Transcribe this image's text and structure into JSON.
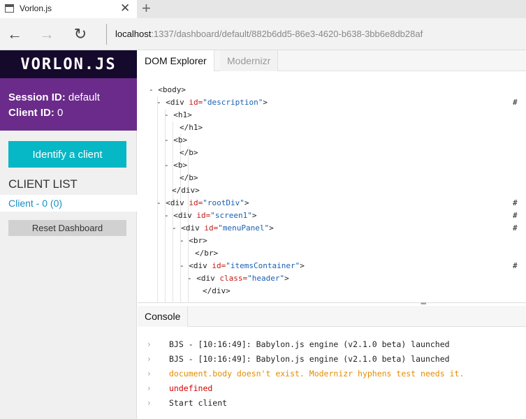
{
  "browser": {
    "tab_title": "Vorlon.js",
    "tab_close": "✕",
    "new_tab": "+",
    "back": "←",
    "forward": "→",
    "refresh": "↻",
    "url_host": "localhost",
    "url_rest": ":1337/dashboard/default/882b6dd5-86e3-4620-b638-3bb6e8db28af"
  },
  "sidebar": {
    "logo": "VORLON.JS",
    "session_label": "Session ID:",
    "session_value": "default",
    "client_label": "Client ID:",
    "client_value": "0",
    "identify_button": "Identify a client",
    "client_list_title": "CLIENT LIST",
    "clients": [
      "Client - 0 (0)"
    ],
    "reset_button": "Reset Dashboard"
  },
  "panels": {
    "tabs": [
      {
        "label": "DOM Explorer",
        "active": true
      },
      {
        "label": "Modernizr",
        "active": false
      }
    ],
    "console_tab": "Console"
  },
  "dom_tree": [
    {
      "indent": 0,
      "prefix": "- ",
      "text": "<body>",
      "attr": "",
      "val": "",
      "suffix": "",
      "hash": ""
    },
    {
      "indent": 1,
      "prefix": "- ",
      "text": "<div ",
      "attr": "id=",
      "val": "\"description\"",
      "suffix": ">",
      "hash": "#"
    },
    {
      "indent": 2,
      "prefix": "- ",
      "text": "<h1>",
      "attr": "",
      "val": "",
      "suffix": "",
      "hash": ""
    },
    {
      "indent": 3,
      "prefix": "",
      "text": "</h1>",
      "attr": "",
      "val": "",
      "suffix": "",
      "hash": ""
    },
    {
      "indent": 2,
      "prefix": "- ",
      "text": "<b>",
      "attr": "",
      "val": "",
      "suffix": "",
      "hash": ""
    },
    {
      "indent": 3,
      "prefix": "",
      "text": "</b>",
      "attr": "",
      "val": "",
      "suffix": "",
      "hash": ""
    },
    {
      "indent": 2,
      "prefix": "- ",
      "text": "<b>",
      "attr": "",
      "val": "",
      "suffix": "",
      "hash": ""
    },
    {
      "indent": 3,
      "prefix": "",
      "text": "</b>",
      "attr": "",
      "val": "",
      "suffix": "",
      "hash": ""
    },
    {
      "indent": 2,
      "prefix": "",
      "text": "</div>",
      "attr": "",
      "val": "",
      "suffix": "",
      "hash": ""
    },
    {
      "indent": 1,
      "prefix": "- ",
      "text": "<div ",
      "attr": "id=",
      "val": "\"rootDiv\"",
      "suffix": ">",
      "hash": "#"
    },
    {
      "indent": 2,
      "prefix": "- ",
      "text": "<div ",
      "attr": "id=",
      "val": "\"screen1\"",
      "suffix": ">",
      "hash": "#"
    },
    {
      "indent": 3,
      "prefix": "- ",
      "text": "<div ",
      "attr": "id=",
      "val": "\"menuPanel\"",
      "suffix": ">",
      "hash": "#"
    },
    {
      "indent": 4,
      "prefix": "- ",
      "text": "<br>",
      "attr": "",
      "val": "",
      "suffix": "",
      "hash": ""
    },
    {
      "indent": 5,
      "prefix": "",
      "text": "</br>",
      "attr": "",
      "val": "",
      "suffix": "",
      "hash": ""
    },
    {
      "indent": 4,
      "prefix": "- ",
      "text": "<div ",
      "attr": "id=",
      "val": "\"itemsContainer\"",
      "suffix": ">",
      "hash": "#"
    },
    {
      "indent": 5,
      "prefix": "- ",
      "text": "<div ",
      "attr": "class=",
      "val": "\"header\"",
      "suffix": ">",
      "hash": ""
    },
    {
      "indent": 6,
      "prefix": "",
      "text": "</div>",
      "attr": "",
      "val": "",
      "suffix": "",
      "hash": ""
    }
  ],
  "console": [
    {
      "level": "log",
      "text": "BJS - [10:16:49]: Babylon.js engine (v2.1.0 beta) launched"
    },
    {
      "level": "log",
      "text": "BJS - [10:16:49]: Babylon.js engine (v2.1.0 beta) launched"
    },
    {
      "level": "warn",
      "text": "document.body doesn't exist. Modernizr hyphens test needs it."
    },
    {
      "level": "error",
      "text": "undefined"
    },
    {
      "level": "log",
      "text": "Start client"
    }
  ],
  "colors": {
    "logo_bg": "#150a2b",
    "session_bg": "#6a2b8a",
    "identify_bg": "#06b7c6",
    "client_link": "#1a8fc4",
    "warn": "#e38c00",
    "error": "#d10000"
  }
}
